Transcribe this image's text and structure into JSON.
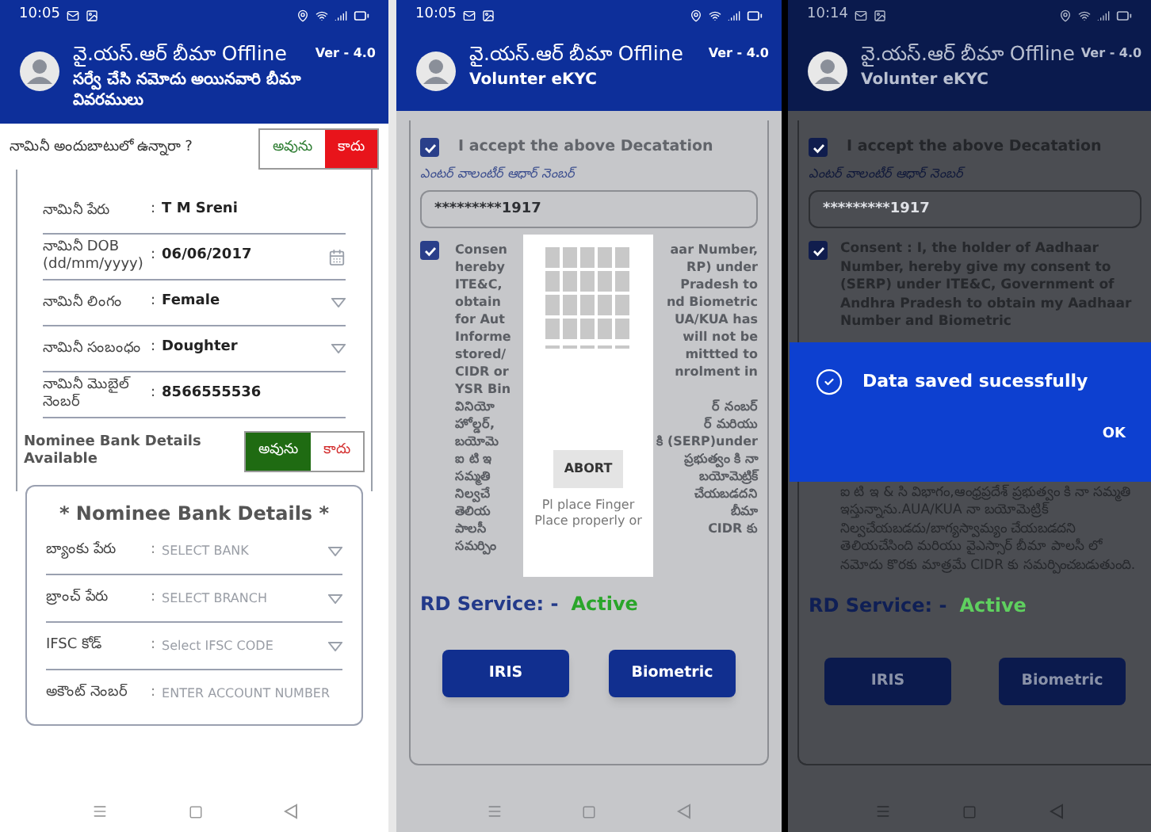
{
  "form_screen": {
    "status_bar": {
      "time": "10:05"
    },
    "header": {
      "title": "వై.యస్.ఆర్ బీమా Offline",
      "subtitle": "సర్వే చేసి నమోదు అయినవారి బీమా వివరములు",
      "version": "Ver - 4.0"
    },
    "nominee_question": {
      "label": "నామినీ అందుబాటులో ఉన్నారా ?",
      "options": [
        {
          "label": "అవును",
          "selected": false
        },
        {
          "label": "కాదు",
          "selected": true
        }
      ]
    },
    "fields": [
      {
        "label": "నామినీ పేరు",
        "separator": ":",
        "value": "T M Sreni",
        "kind": "text"
      },
      {
        "label": "నామినీ DOB (dd/mm/yyyy)",
        "separator": ":",
        "value": "06/06/2017",
        "kind": "date"
      },
      {
        "label": "నామినీ లింగం",
        "separator": ":",
        "value": "Female",
        "kind": "select"
      },
      {
        "label": "నామినీ సంబంధం",
        "separator": ":",
        "value": "Doughter",
        "kind": "select"
      },
      {
        "label": "నామినీ మొబైల్ నెంబర్",
        "separator": ":",
        "value": "8566555536",
        "kind": "text"
      }
    ],
    "bank_question": {
      "label": "Nominee Bank Details Available",
      "options": [
        {
          "label": "అవును",
          "selected": true
        },
        {
          "label": "కాదు",
          "selected": false
        }
      ]
    },
    "bank_section": {
      "title": "* Nominee Bank Details *",
      "fields": [
        {
          "label": "బ్యాంకు పేరు",
          "separator": ":",
          "placeholder": "SELECT BANK",
          "kind": "select"
        },
        {
          "label": "బ్రాంచ్ పేరు",
          "separator": ":",
          "placeholder": "SELECT BRANCH",
          "kind": "select"
        },
        {
          "label": "IFSC కోడ్",
          "separator": ":",
          "placeholder": "Select IFSC CODE",
          "kind": "select"
        },
        {
          "label": "అకౌంట్ నెంబర్",
          "separator": ":",
          "placeholder": "ENTER ACCOUNT NUMBER",
          "kind": "text"
        }
      ]
    }
  },
  "capture_screen": {
    "status_bar": {
      "time": "10:05"
    },
    "header": {
      "title": "వై.యస్.ఆర్ బీమా Offline",
      "subtitle": "Volunter eKYC",
      "version": "Ver - 4.0"
    },
    "declaration": {
      "label": "I accept the above Decatation",
      "checked": true
    },
    "aadhaar_label": "ఎంటర్ వాలంటీర్ ఆధార్ నెంబర్",
    "aadhaar_field": {
      "value": "*********1917"
    },
    "consent": {
      "checked": true,
      "lines": [
        {
          "left": "Consen",
          "right": "aar Number,"
        },
        {
          "left": "hereby",
          "right": "RP) under"
        },
        {
          "left": "ITE&C,",
          "right": "Pradesh to"
        },
        {
          "left": "obtain",
          "right": "nd Biometric"
        },
        {
          "left": "for Aut",
          "right": "UA/KUA has"
        },
        {
          "left": "Informe",
          "right": "will not be"
        },
        {
          "left": "stored/",
          "right": "mittted to"
        },
        {
          "left": "CIDR or",
          "right": "nrolment in"
        },
        {
          "left": "YSR Bin"
        },
        {
          "left": "వినియో",
          "right": "ర్ నంబర్"
        },
        {
          "left": "హోల్డర్,",
          "right": "ర్ మరియు"
        },
        {
          "left": "బయోమె",
          "right": "కి (SERP)under"
        },
        {
          "left": "ఐ టి ఇ",
          "right": "ప్రభుత్వం కి నా"
        },
        {
          "left": "సమ్మతి",
          "right": "బయోమెట్రిక్"
        },
        {
          "left": "నిల్వచే",
          "right": "చేయబడదని"
        },
        {
          "left": "తెలియ",
          "right": "బీమా"
        },
        {
          "left": "పాలసీ",
          "right": "CIDR కు"
        },
        {
          "left": "సమర్పిం"
        }
      ]
    },
    "scanner_popup": {
      "button": "ABORT",
      "message": "Pl place Finger Place properly or"
    },
    "rd_service": {
      "label": "RD Service: -",
      "status": "Active"
    },
    "buttons": [
      "IRIS",
      "Biometric"
    ]
  },
  "saved_screen": {
    "status_bar": {
      "time": "10:14"
    },
    "header": {
      "title": "వై.యస్.ఆర్ బీమా Offline",
      "subtitle": "Volunter eKYC",
      "version": "Ver - 4.0"
    },
    "declaration": {
      "label": "I accept the above Decatation",
      "checked": true
    },
    "aadhaar_label": "ఎంటర్ వాలంటీర్ ఆధార్ నెంబర్",
    "aadhaar_field": {
      "value": "*********1917"
    },
    "consent": {
      "checked": true,
      "text": "Consent : I, the holder of Aadhaar Number, hereby give my consent to (SERP) under ITE&C, Government of Andhra Pradesh to obtain my Aadhaar Number and Biometric",
      "text_below": "ఐ టి ఇ & సి విభాగం,ఆంధ్రప్రదేశ్ ప్రభుత్వం కి నా సమ్మతి ఇస్తున్నాను.AUA/KUA నా బయోమెట్రిక్ నిల్వచేయబడదు/బాగ్యస్వామ్యం చేయబడదని తెలియచేసింది మరియు వైఎస్సార్ బీమా పాలసీ లో నమోదు కొరకు మాత్రమే CIDR కు సమర్పించబడుతుంది."
    },
    "dialog": {
      "message": "Data saved sucessfully",
      "button": "OK"
    },
    "rd_service": {
      "label": "RD Service: -",
      "status": "Active"
    },
    "buttons": [
      "IRIS",
      "Biometric"
    ]
  }
}
